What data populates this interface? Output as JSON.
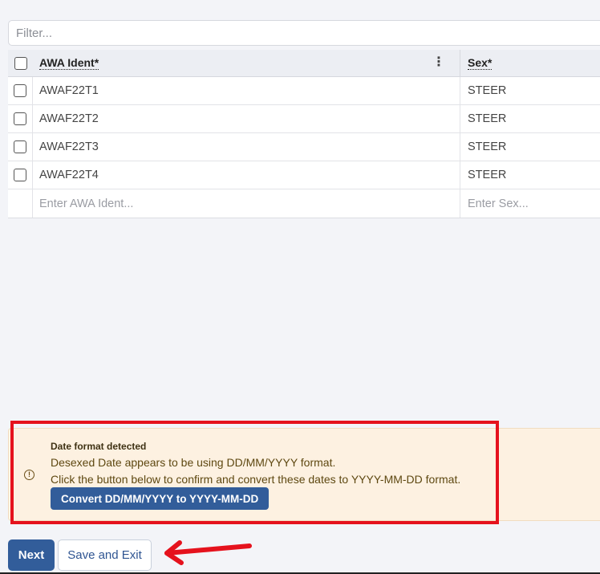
{
  "filter": {
    "placeholder": "Filter..."
  },
  "table": {
    "columns": {
      "ident": "AWA Ident*",
      "sex": "Sex*"
    },
    "rows": [
      {
        "ident": "AWAF22T1",
        "sex": "STEER"
      },
      {
        "ident": "AWAF22T2",
        "sex": "STEER"
      },
      {
        "ident": "AWAF22T3",
        "sex": "STEER"
      },
      {
        "ident": "AWAF22T4",
        "sex": "STEER"
      }
    ],
    "new_row": {
      "ident_placeholder": "Enter AWA Ident...",
      "sex_placeholder": "Enter Sex..."
    }
  },
  "alert": {
    "title": "Date format detected",
    "line1": "Desexed Date appears to be using DD/MM/YYYY format.",
    "line2": "Click the button below to confirm and convert these dates to YYYY-MM-DD format.",
    "button": "Convert DD/MM/YYYY to YYYY-MM-DD",
    "icon": "alert-circle-icon"
  },
  "footer": {
    "next": "Next",
    "save_exit": "Save and Exit"
  },
  "colors": {
    "primary": "#325d9a",
    "annotation": "#e5121d",
    "alert_bg": "#fdf1e1"
  }
}
